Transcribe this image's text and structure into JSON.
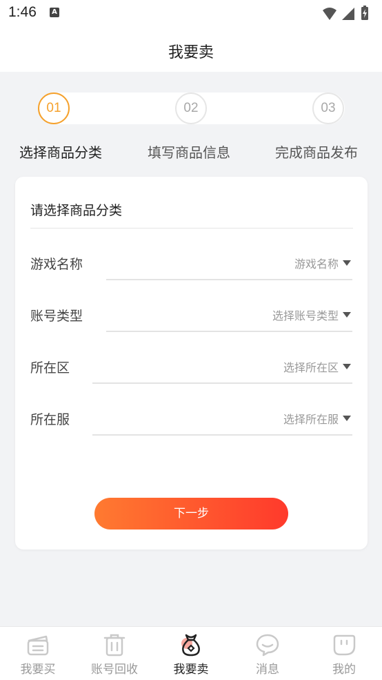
{
  "status": {
    "time": "1:46",
    "notif_letter": "A"
  },
  "header": {
    "title": "我要卖"
  },
  "steps": [
    {
      "number": "01",
      "label": "选择商品分类",
      "active": true
    },
    {
      "number": "02",
      "label": "填写商品信息",
      "active": false
    },
    {
      "number": "03",
      "label": "完成商品发布",
      "active": false
    }
  ],
  "form": {
    "title": "请选择商品分类",
    "fields": [
      {
        "label": "游戏名称",
        "placeholder": "游戏名称"
      },
      {
        "label": "账号类型",
        "placeholder": "选择账号类型"
      },
      {
        "label": "所在区",
        "placeholder": "选择所在区"
      },
      {
        "label": "所在服",
        "placeholder": "选择所在服"
      }
    ],
    "next_label": "下一步"
  },
  "tabbar": [
    {
      "label": "我要买",
      "icon": "buy-icon"
    },
    {
      "label": "账号回收",
      "icon": "trash-icon"
    },
    {
      "label": "我要卖",
      "icon": "money-bag-icon",
      "active": true
    },
    {
      "label": "消息",
      "icon": "chat-icon"
    },
    {
      "label": "我的",
      "icon": "profile-icon"
    }
  ],
  "colors": {
    "accent": "#f5a12c",
    "button_start": "#ff7a30",
    "button_end": "#ff3a2c"
  }
}
